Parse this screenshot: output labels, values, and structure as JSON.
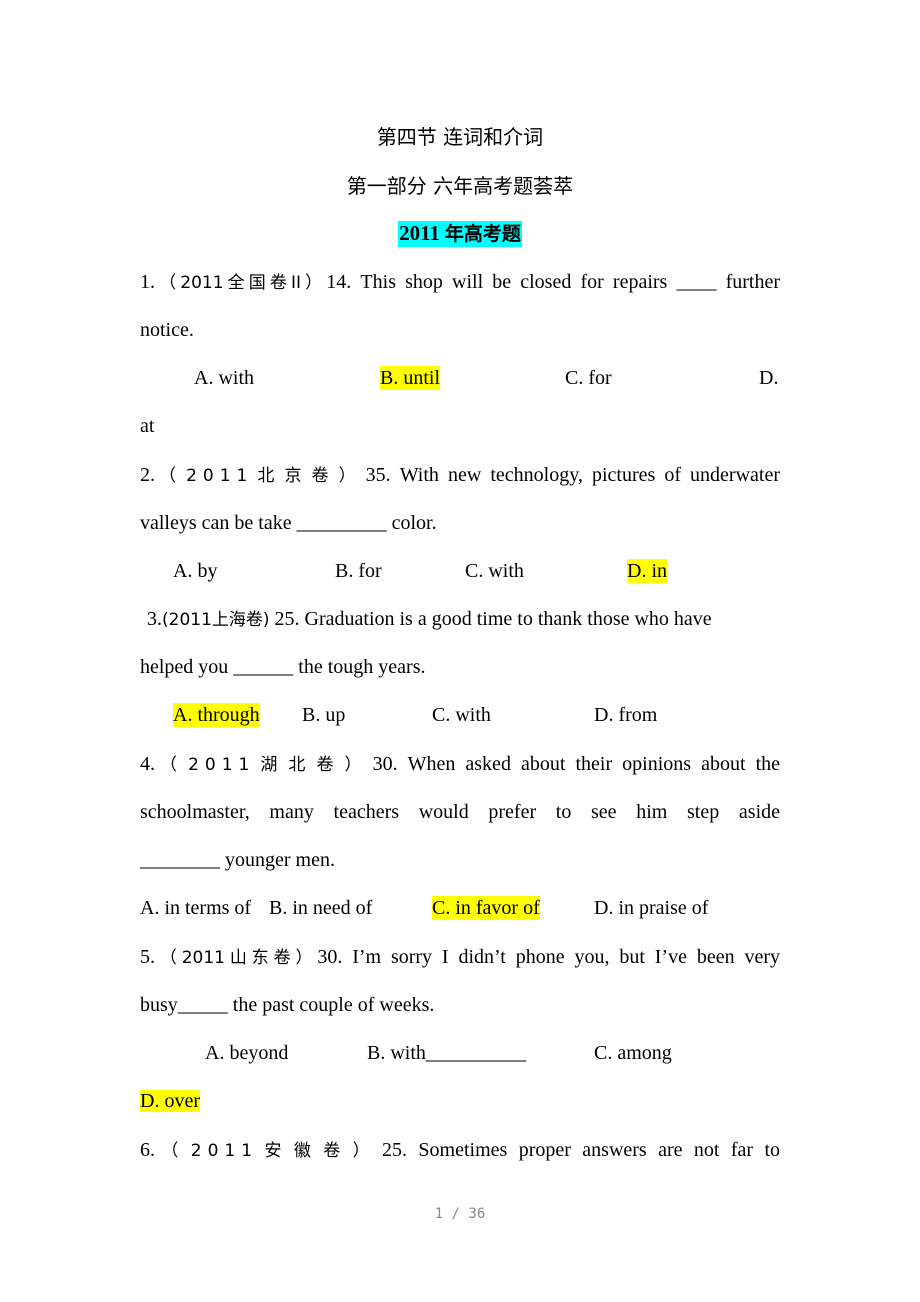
{
  "document": {
    "section_title": "第四节  连词和介词",
    "part_title": "第一部分    六年高考题荟萃",
    "year_heading": {
      "number": "2011",
      "text": "年高考题"
    },
    "highlight_colors": {
      "answer": "#ffff00",
      "heading": "#00ffff"
    },
    "questions": [
      {
        "index": "1.",
        "source": "（2011全国卷II）",
        "stem_line1": "14. This shop will be closed for repairs ____ further",
        "stem_line2": "notice.",
        "options": [
          "A. with",
          "B. until",
          "C. for",
          "D."
        ],
        "option_wrap": "at",
        "answer": "B"
      },
      {
        "index": "2.",
        "source": "（2011北京卷）",
        "stem_line1": "35. With new technology, pictures of underwater",
        "stem_line2": "valleys can be take _________ color.",
        "options": [
          "A. by",
          "B. for",
          "C. with",
          "D. in"
        ],
        "answer": "D"
      },
      {
        "index": "3.",
        "source": "(2011上海卷)",
        "stem_line1": "25. Graduation is a good time to thank those who have",
        "stem_line2": "helped you ______ the tough years.",
        "options": [
          "A. through",
          "B. up",
          "C. with",
          "D. from"
        ],
        "answer": "A"
      },
      {
        "index": "4.",
        "source": "（2011湖北卷）",
        "stem_line1": "30. When asked about their opinions about the",
        "stem_line2": "schoolmaster, many teachers would prefer to see him step aside",
        "stem_line3": "________ younger men.",
        "options": [
          "A. in terms of",
          "B. in need of",
          "C. in favor of",
          "D. in praise of"
        ],
        "answer": "C"
      },
      {
        "index": "5.",
        "source": "（2011山东卷）",
        "stem_line1": "30. I’m sorry I didn’t phone you, but I’ve been very",
        "stem_line2": "busy_____ the past couple of weeks.",
        "options": [
          "A. beyond",
          "B. with__________",
          "C. among"
        ],
        "option_wrap": "D. over",
        "answer": "D"
      },
      {
        "index": "6.",
        "source": "（2011安徽卷）",
        "stem_line1": "25. Sometimes proper answers are not far to"
      }
    ]
  },
  "footer": {
    "page_indicator": "1 / 36"
  }
}
